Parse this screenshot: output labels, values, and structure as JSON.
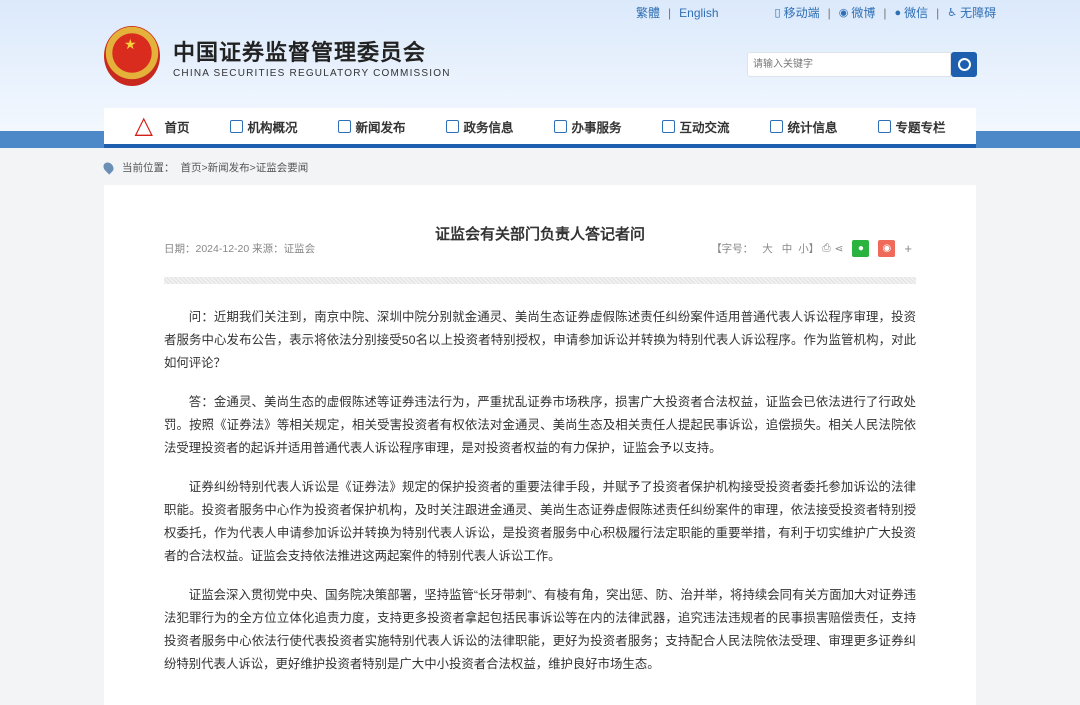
{
  "top_links": {
    "traditional": "繁體",
    "english": "English",
    "mobile": "移动端",
    "weibo": "微博",
    "wechat": "微信",
    "accessibility": "无障碍"
  },
  "site": {
    "title_cn": "中国证券监督管理委员会",
    "title_en": "CHINA SECURITIES REGULATORY COMMISSION"
  },
  "search": {
    "placeholder": "请输入关键字"
  },
  "nav": [
    "首页",
    "机构概况",
    "新闻发布",
    "政务信息",
    "办事服务",
    "互动交流",
    "统计信息",
    "专题专栏"
  ],
  "breadcrumb": {
    "label": "当前位置：",
    "path": "首页>新闻发布>证监会要闻"
  },
  "article": {
    "title": "证监会有关部门负责人答记者问",
    "meta": "日期：2024-12-20 来源：证监会",
    "font_size_label": "【字号：",
    "font_sizes": [
      "大",
      "中",
      "小】"
    ],
    "paragraphs": [
      "问：近期我们关注到，南京中院、深圳中院分别就金通灵、美尚生态证券虚假陈述责任纠纷案件适用普通代表人诉讼程序审理，投资者服务中心发布公告，表示将依法分别接受50名以上投资者特别授权，申请参加诉讼并转换为特别代表人诉讼程序。作为监管机构，对此如何评论？",
      "答：金通灵、美尚生态的虚假陈述等证券违法行为，严重扰乱证券市场秩序，损害广大投资者合法权益，证监会已依法进行了行政处罚。按照《证券法》等相关规定，相关受害投资者有权依法对金通灵、美尚生态及相关责任人提起民事诉讼，追偿损失。相关人民法院依法受理投资者的起诉并适用普通代表人诉讼程序审理，是对投资者权益的有力保护，证监会予以支持。",
      "证券纠纷特别代表人诉讼是《证券法》规定的保护投资者的重要法律手段，并赋予了投资者保护机构接受投资者委托参加诉讼的法律职能。投资者服务中心作为投资者保护机构，及时关注跟进金通灵、美尚生态证券虚假陈述责任纠纷案件的审理，依法接受投资者特别授权委托，作为代表人申请参加诉讼并转换为特别代表人诉讼，是投资者服务中心积极履行法定职能的重要举措，有利于切实维护广大投资者的合法权益。证监会支持依法推进这两起案件的特别代表人诉讼工作。",
      "证监会深入贯彻党中央、国务院决策部署，坚持监管“长牙带刺”、有棱有角，突出惩、防、治并举，将持续会同有关方面加大对证券违法犯罪行为的全方位立体化追责力度，支持更多投资者拿起包括民事诉讼等在内的法律武器，追究违法违规者的民事损害赔偿责任，支持投资者服务中心依法行使代表投资者实施特别代表人诉讼的法律职能，更好为投资者服务；支持配合人民法院依法受理、审理更多证券纠纷特别代表人诉讼，更好维护投资者特别是广大中小投资者合法权益，维护良好市场生态。"
    ]
  },
  "colors": {
    "brand": "#1d5fae",
    "band": "#4d88c8",
    "wechat": "#2bb33f",
    "weibo": "#f06a5a"
  }
}
